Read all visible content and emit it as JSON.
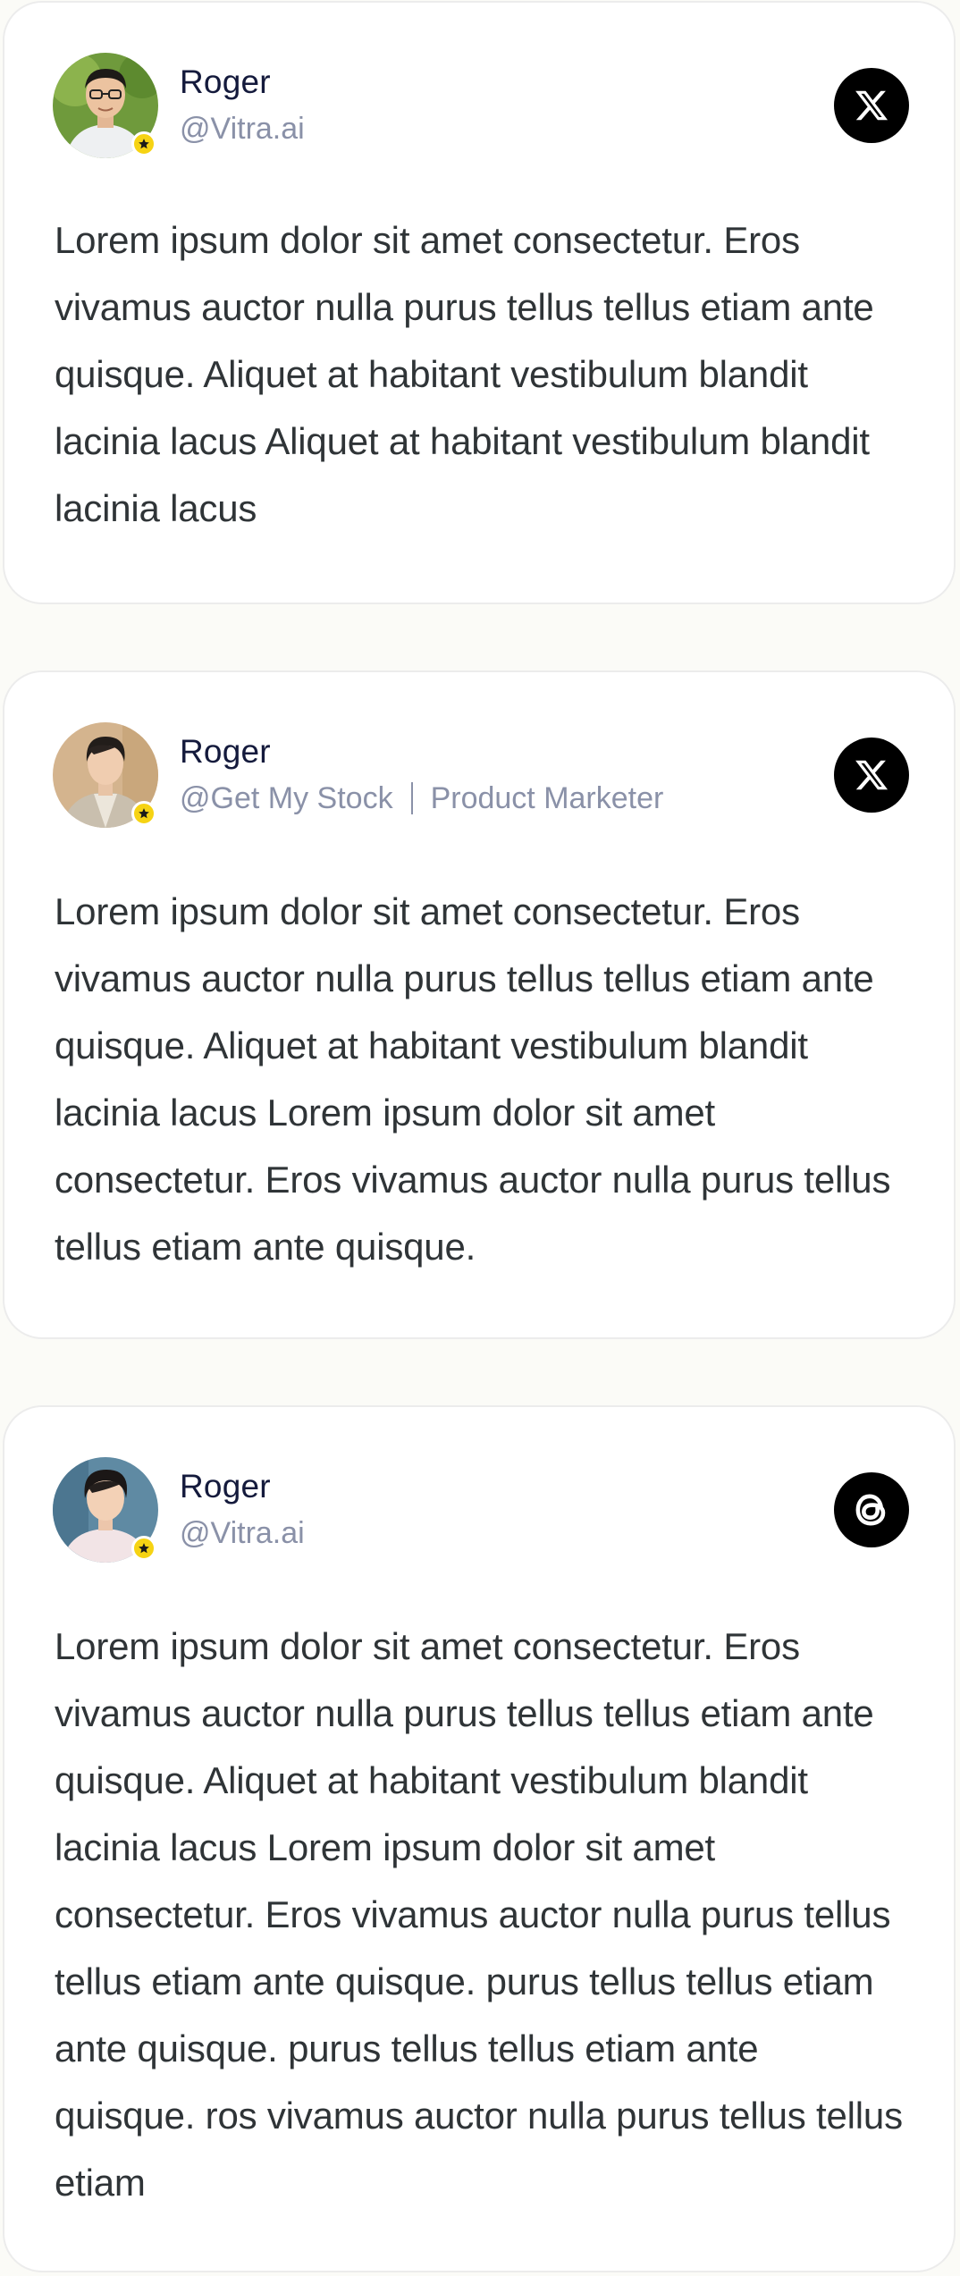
{
  "cards": [
    {
      "name": "Roger",
      "handle": "@Vitra.ai",
      "role": "",
      "platform_icon": "x-logo-icon",
      "text": "Lorem ipsum dolor sit amet consectetur. Eros vivamus auctor nulla purus tellus tellus etiam ante quisque. Aliquet at habitant vestibulum blandit lacinia lacus Aliquet at habitant vestibulum blandit lacinia lacus"
    },
    {
      "name": "Roger",
      "handle": "@Get My Stock",
      "role": "Product Marketer",
      "platform_icon": "x-logo-icon",
      "text": "Lorem ipsum dolor sit amet consectetur. Eros vivamus auctor nulla purus tellus tellus etiam ante quisque. Aliquet at habitant vestibulum blandit lacinia lacus Lorem ipsum dolor sit amet consectetur. Eros vivamus auctor nulla purus tellus tellus etiam ante quisque."
    },
    {
      "name": "Roger",
      "handle": "@Vitra.ai",
      "role": "",
      "platform_icon": "threads-logo-icon",
      "text": "Lorem ipsum dolor sit amet consectetur. Eros vivamus auctor nulla purus tellus tellus etiam ante quisque. Aliquet at habitant vestibulum blandit lacinia lacus Lorem ipsum dolor sit amet consectetur. Eros vivamus auctor nulla purus tellus tellus etiam ante quisque. purus tellus tellus etiam ante quisque. purus tellus tellus etiam ante quisque. ros vivamus auctor nulla purus tellus tellus etiam"
    }
  ],
  "colors": {
    "page_background": "#fbfbf7",
    "card_background": "#ffffff",
    "card_border": "#ececec",
    "name_text": "#141a3c",
    "meta_text": "#8a91a8",
    "body_text": "#2f3437",
    "badge": "#f6d313",
    "social_icon_bg": "#000000"
  }
}
